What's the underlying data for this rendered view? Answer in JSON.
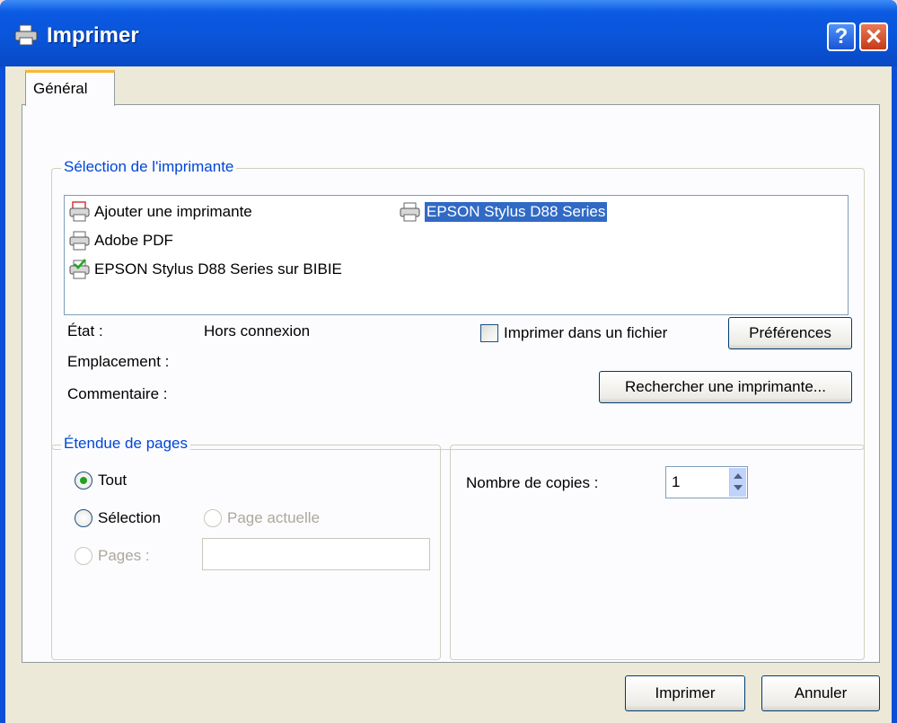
{
  "window": {
    "title": "Imprimer",
    "help_label": "?",
    "close_label": "✕",
    "icon": "printer-icon"
  },
  "tabs": [
    {
      "label": "Général",
      "selected": true
    }
  ],
  "printer_group": {
    "legend": "Sélection de l'imprimante",
    "printers": [
      {
        "label": "Ajouter une imprimante",
        "icon": "add-printer-icon"
      },
      {
        "label": "Adobe PDF",
        "icon": "printer-icon"
      },
      {
        "label": "EPSON Stylus D88 Series sur BIBIE",
        "icon": "network-printer-icon"
      },
      {
        "label": "EPSON Stylus D88 Series",
        "icon": "printer-icon",
        "selected": true
      }
    ],
    "status_label": "État :",
    "status_value": "Hors connexion",
    "location_label": "Emplacement :",
    "location_value": "",
    "comment_label": "Commentaire :",
    "comment_value": "",
    "print_to_file_label": "Imprimer dans un fichier",
    "print_to_file_checked": false,
    "preferences_label": "Préférences",
    "find_printer_label": "Rechercher une imprimante..."
  },
  "page_range": {
    "legend": "Étendue de pages",
    "all_label": "Tout",
    "all_selected": true,
    "selection_label": "Sélection",
    "current_page_label": "Page actuelle",
    "pages_label": "Pages :",
    "pages_value": ""
  },
  "copies": {
    "label": "Nombre de copies :",
    "value": "1"
  },
  "buttons": {
    "print_label": "Imprimer",
    "cancel_label": "Annuler"
  },
  "colors": {
    "titlebar": "#0a54d8",
    "selection": "#316ac5",
    "legend_text": "#0046d5",
    "dialog_bg": "#ece9d8"
  }
}
